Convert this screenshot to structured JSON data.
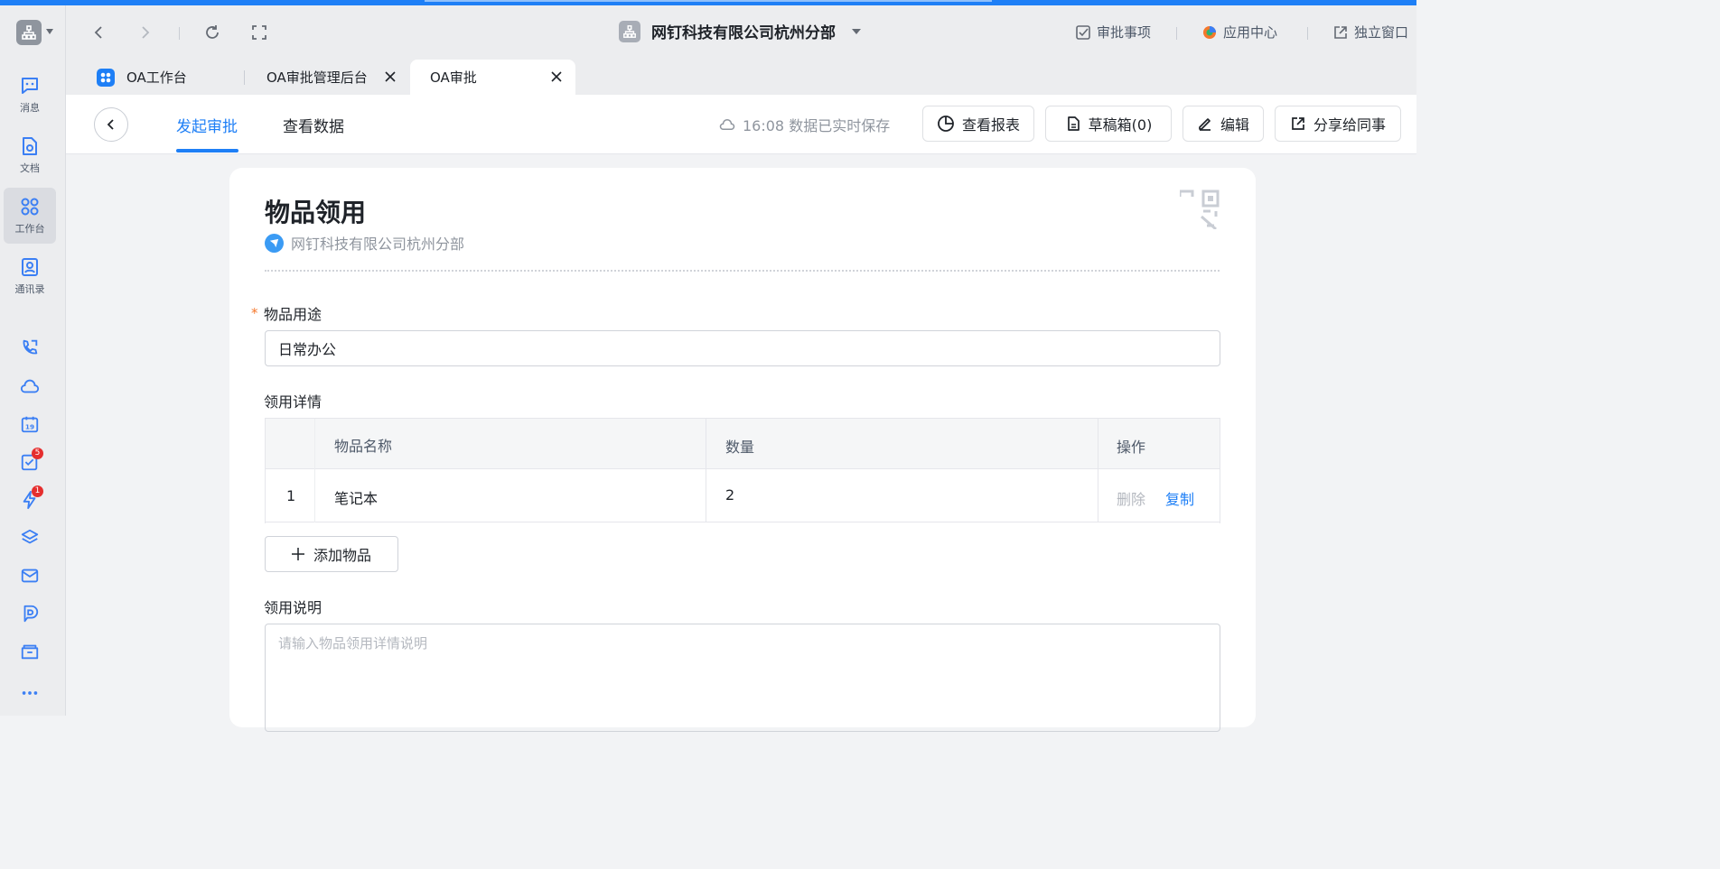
{
  "sidebar": {
    "items": [
      {
        "label": "消息",
        "icon": "chat-icon"
      },
      {
        "label": "文档",
        "icon": "document-icon"
      },
      {
        "label": "工作台",
        "icon": "grid-icon",
        "active": true
      },
      {
        "label": "通讯录",
        "icon": "contacts-icon"
      }
    ],
    "shortcuts": [
      {
        "icon": "phone-icon"
      },
      {
        "icon": "cloud-icon"
      },
      {
        "icon": "calendar-icon",
        "text": "19"
      },
      {
        "icon": "todo-icon",
        "badge": "5"
      },
      {
        "icon": "lightning-icon",
        "badge": "1"
      },
      {
        "icon": "cube-icon"
      },
      {
        "icon": "mail-icon"
      },
      {
        "icon": "doc-d-icon"
      },
      {
        "icon": "folder-icon"
      },
      {
        "icon": "more-icon"
      }
    ]
  },
  "titlebar": {
    "org_name": "网钉科技有限公司杭州分部",
    "links": {
      "approval": "审批事项",
      "app_center": "应用中心",
      "standalone": "独立窗口"
    }
  },
  "tabs": [
    {
      "label": "OA工作台",
      "closable": false
    },
    {
      "label": "OA审批管理后台",
      "closable": true
    },
    {
      "label": "OA审批",
      "closable": true,
      "active": true
    }
  ],
  "header": {
    "tabs": [
      {
        "label": "发起审批",
        "active": true
      },
      {
        "label": "查看数据"
      }
    ],
    "save_status": "16:08 数据已实时保存",
    "buttons": {
      "report": "查看报表",
      "drafts": "草稿箱(0)",
      "edit": "编辑",
      "share": "分享给同事"
    }
  },
  "form": {
    "title": "物品领用",
    "org": "网钉科技有限公司杭州分部",
    "purpose": {
      "label": "物品用途",
      "required_mark": "*",
      "value": "日常办公"
    },
    "details": {
      "label": "领用详情",
      "columns": [
        "物品名称",
        "数量",
        "操作"
      ],
      "rows": [
        {
          "index": "1",
          "name": "笔记本",
          "qty": "2",
          "delete": "删除",
          "copy": "复制"
        }
      ],
      "add_label": "添加物品"
    },
    "note": {
      "label": "领用说明",
      "placeholder": "请输入物品领用详情说明"
    }
  },
  "colors": {
    "accent": "#1e7ff6",
    "badge": "#e52e2e",
    "required": "#f5772b"
  }
}
